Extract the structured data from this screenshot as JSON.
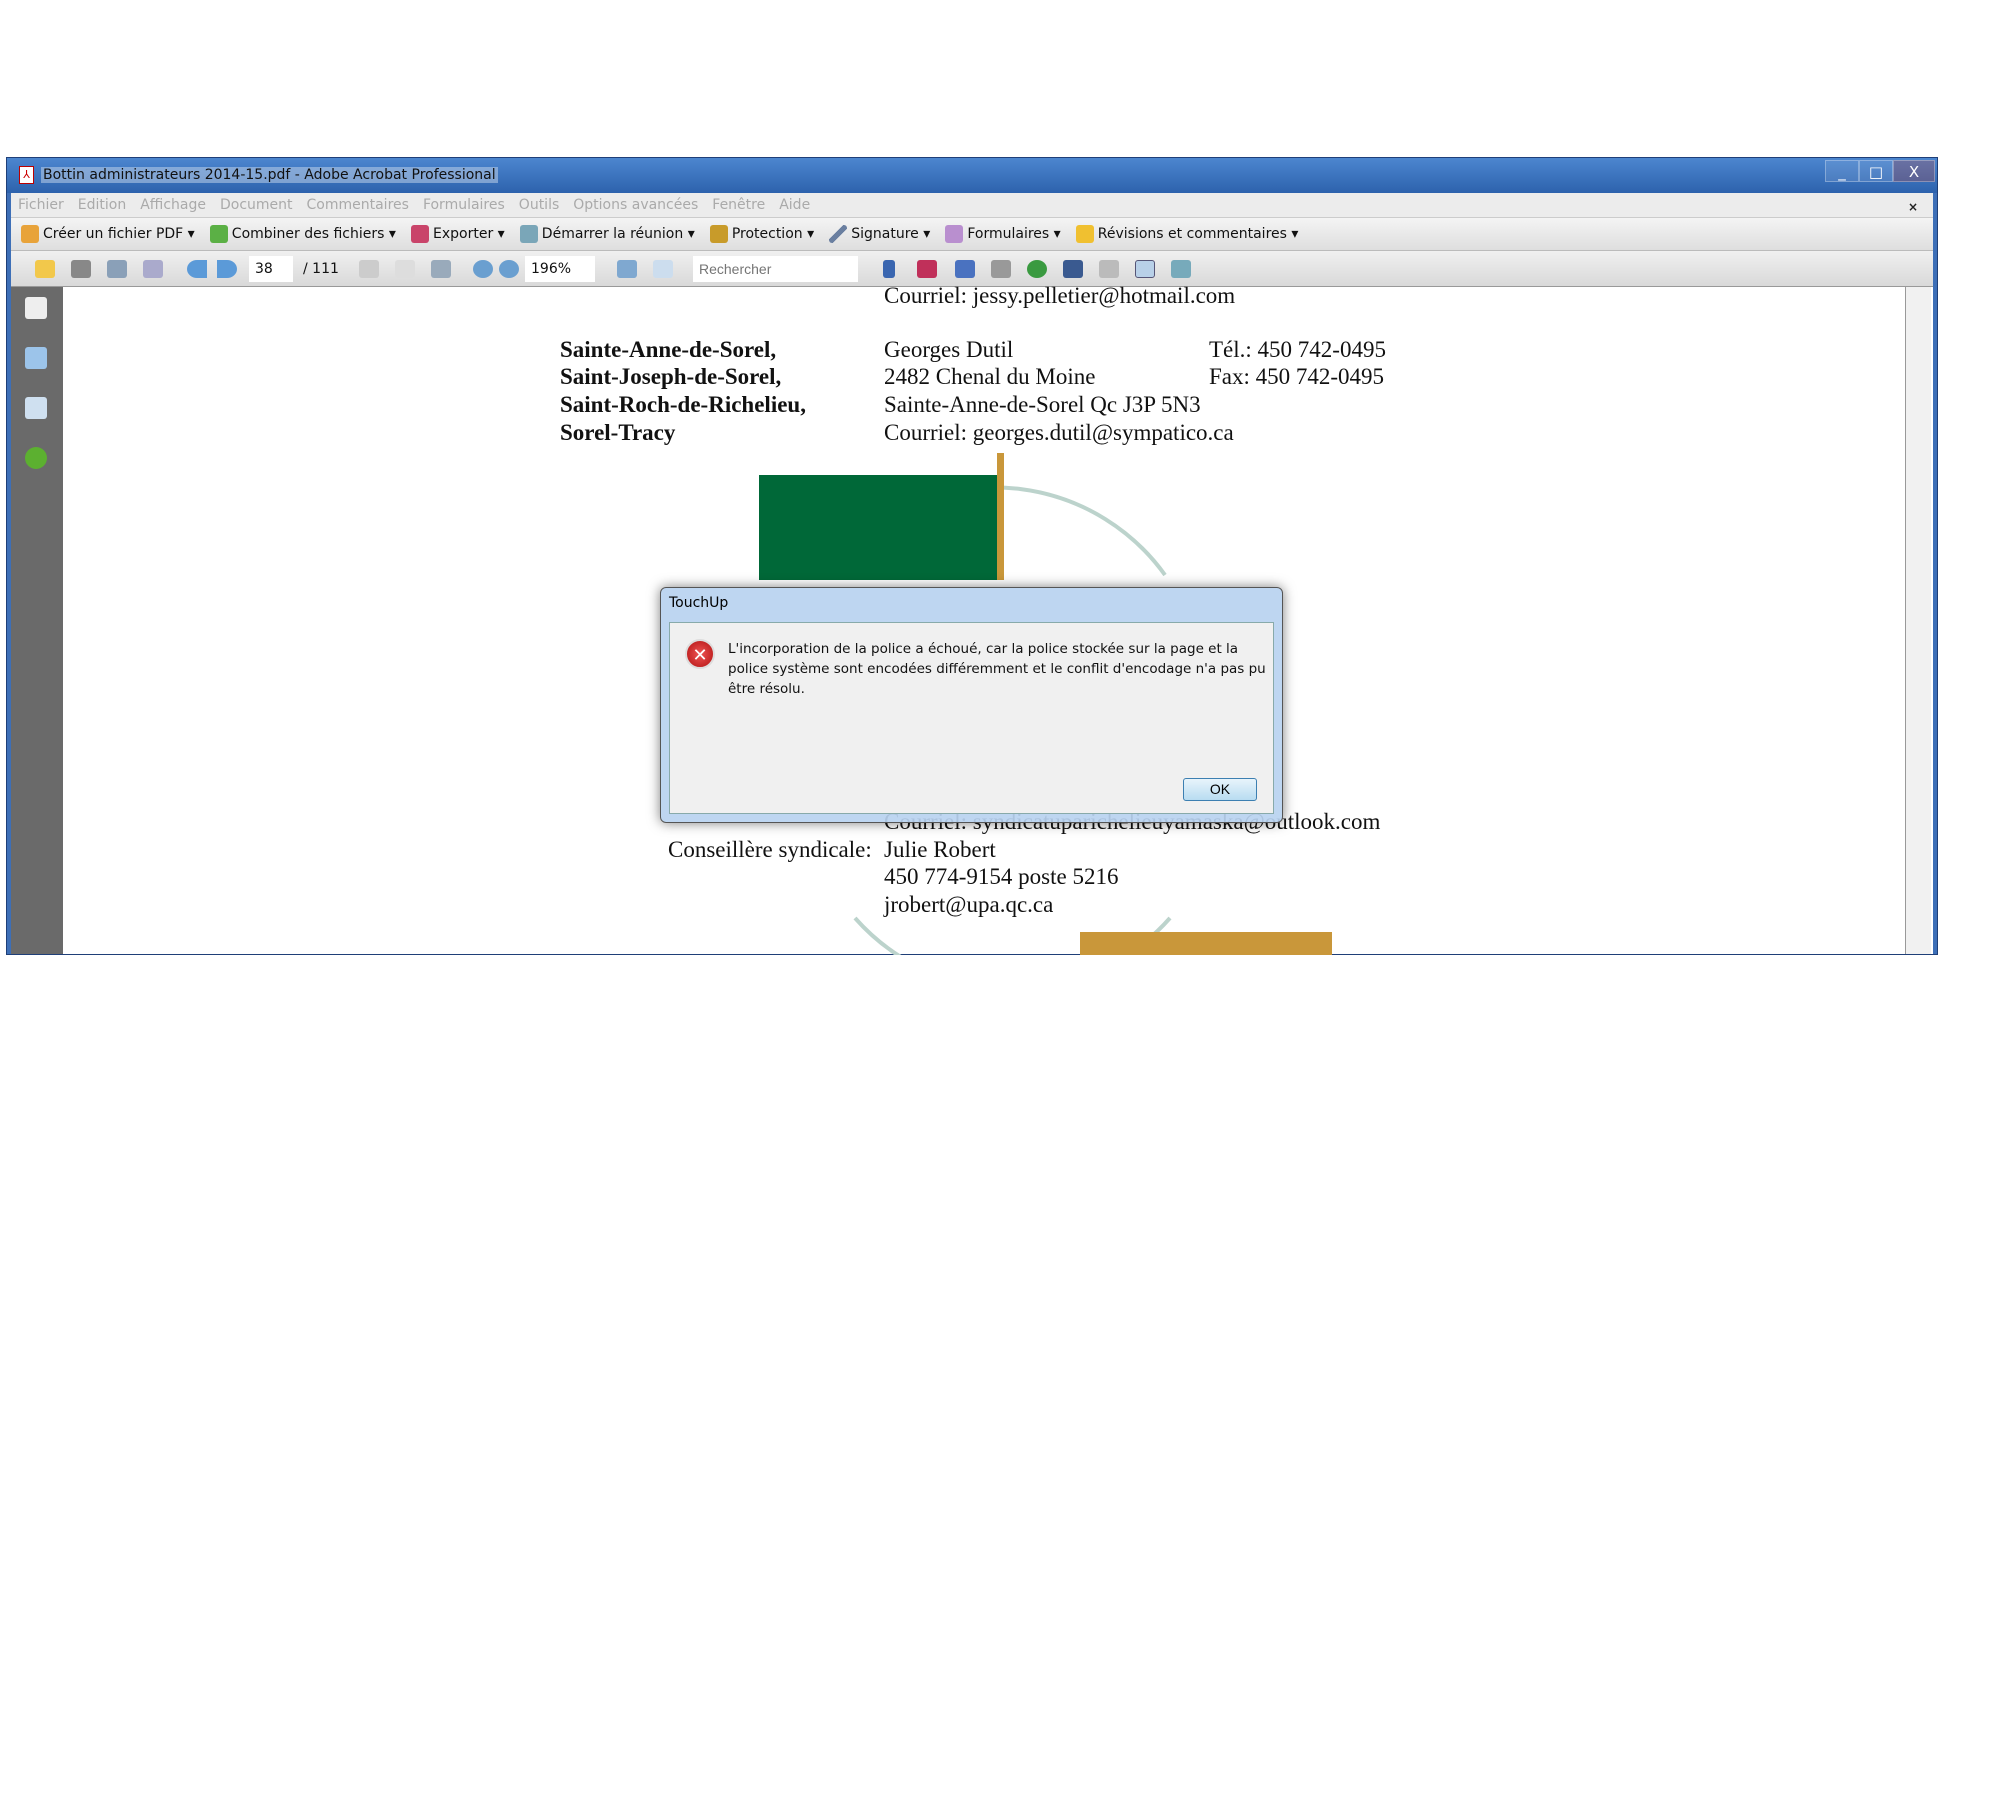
{
  "window": {
    "title": "Bottin administrateurs 2014-15.pdf - Adobe Acrobat Professional",
    "minimize": "_",
    "maximize": "□",
    "close": "X",
    "close_doc": "×"
  },
  "menu": [
    "Fichier",
    "Edition",
    "Affichage",
    "Document",
    "Commentaires",
    "Formulaires",
    "Outils",
    "Options avancées",
    "Fenêtre",
    "Aide"
  ],
  "toolbar1": [
    "Créer un fichier PDF ▾",
    "Combiner des fichiers ▾",
    "Exporter ▾",
    "Démarrer la réunion ▾",
    "Protection ▾",
    "Signature ▾",
    "Formulaires ▾",
    "Révisions et commentaires ▾"
  ],
  "toolbar2": {
    "page": "38",
    "page_total": "/ 111",
    "zoom": "196%",
    "search_placeholder": "Rechercher"
  },
  "document": {
    "top_email": "Courriel:  jessy.pelletier@hotmail.com",
    "places": [
      "Sainte-Anne-de-Sorel,",
      "Saint-Joseph-de-Sorel,",
      "Saint-Roch-de-Richelieu,",
      "Sorel-Tracy"
    ],
    "contact": [
      "Georges Dutil",
      "2482 Chenal du Moine",
      "Sainte-Anne-de-Sorel Qc  J3P 5N3",
      "Courriel:  georges.dutil@sympatico.ca"
    ],
    "phone": "Tél.:  450 742-0495",
    "fax": "Fax:  450 742-0495",
    "bottom_email": "Courriel: syndicatuparichelieuyamaska@outlook.com",
    "advisor_label": "Conseillère syndicale:",
    "advisor": [
      "Julie Robert",
      "450 774-9154 poste 5216",
      "jrobert@upa.qc.ca"
    ],
    "colors": {
      "green": "#006838",
      "gold": "#c9973a"
    }
  },
  "dialog": {
    "title": "TouchUp",
    "message": "L'incorporation de la police a échoué, car la police stockée sur la page et la police système sont encodées différemment et le conflit d'encodage n'a pas pu être résolu.",
    "ok": "OK",
    "icon": "error-icon"
  }
}
